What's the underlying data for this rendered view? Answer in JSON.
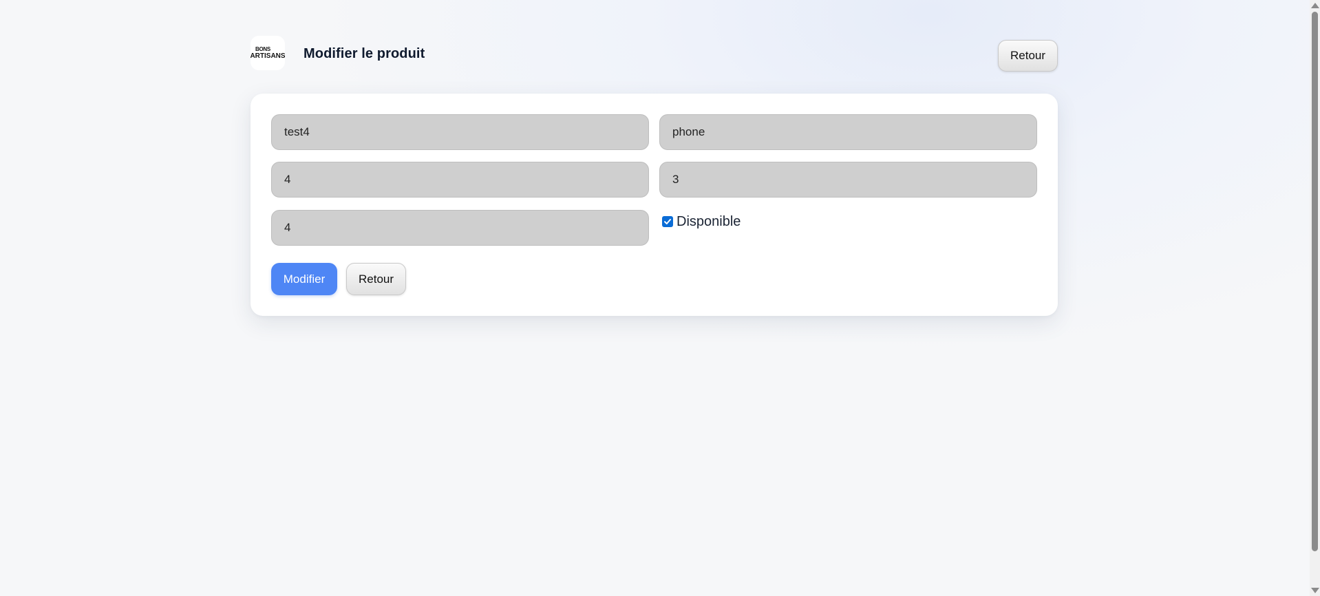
{
  "header": {
    "logo_top": "BONS",
    "logo_bottom": "ARTISANS",
    "title": "Modifier le produit",
    "back_label": "Retour"
  },
  "form": {
    "fields": [
      {
        "value": "test4"
      },
      {
        "value": "phone"
      },
      {
        "value": "4"
      },
      {
        "value": "3"
      },
      {
        "value": "4"
      }
    ],
    "available_checked": true,
    "available_label": "Disponible",
    "submit_label": "Modifier",
    "back_label": "Retour"
  },
  "colors": {
    "primary": "#4e86f5",
    "checkbox": "#0a6cd6",
    "field_bg": "#cfcfcf"
  }
}
